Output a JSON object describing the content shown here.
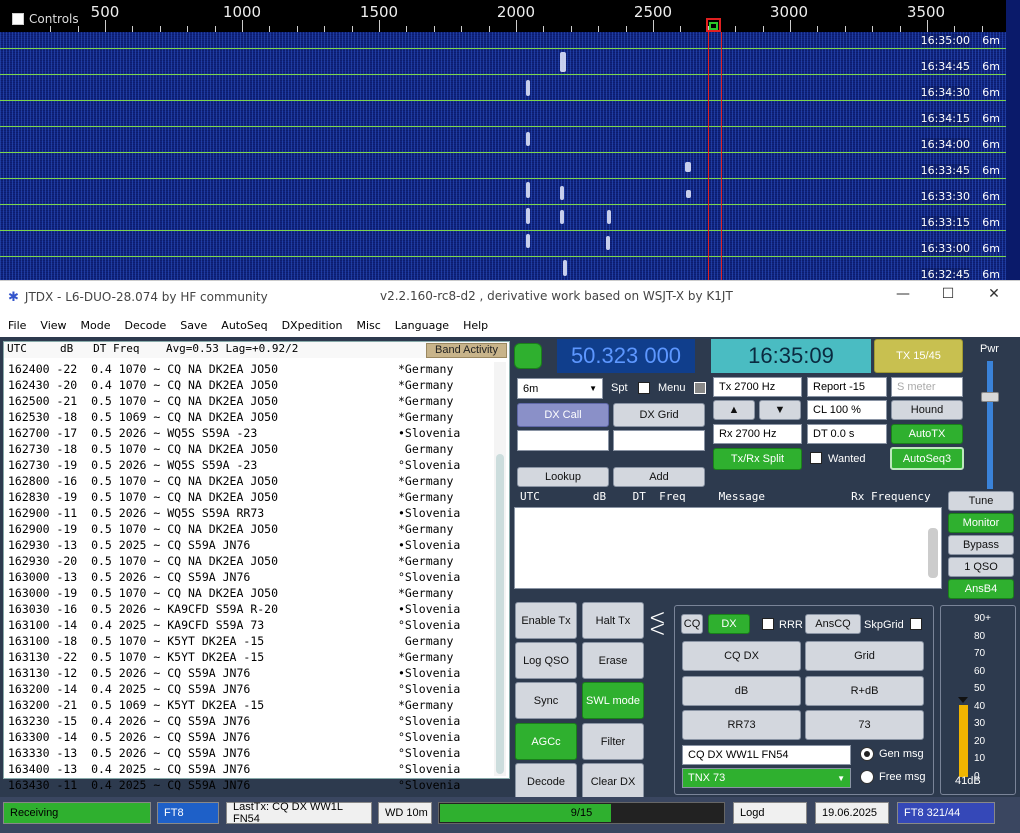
{
  "waterfall": {
    "controls_label": "Controls",
    "scale_labels": [
      "500",
      "1000",
      "1500",
      "2000",
      "2500",
      "3000",
      "3500"
    ],
    "times": [
      "16:35:00",
      "16:34:45",
      "16:34:30",
      "16:34:15",
      "16:34:00",
      "16:33:45",
      "16:33:30",
      "16:33:15",
      "16:33:00",
      "16:32:45"
    ],
    "band": "6m"
  },
  "titlebar": {
    "title": "JTDX - L6-DUO-28.074  by HF community",
    "version": "v2.2.160-rc8-d2 , derivative work based on WSJT-X by K1JT",
    "minimize": "—",
    "maximize": "☐",
    "close": "✕"
  },
  "menu": [
    "File",
    "View",
    "Mode",
    "Decode",
    "Save",
    "AutoSeq",
    "DXpedition",
    "Misc",
    "Language",
    "Help"
  ],
  "band_activity": {
    "header": "UTC     dB   DT Freq    Avg=0.53 Lag=+0.92/2",
    "button": "Band Activity",
    "rows": [
      {
        "t": "162400 -22  0.4 1070 ~ CQ NA DK2EA JO50",
        "c": "*Germany"
      },
      {
        "t": "162430 -20  0.4 1070 ~ CQ NA DK2EA JO50",
        "c": "*Germany"
      },
      {
        "t": "162500 -21  0.5 1070 ~ CQ NA DK2EA JO50",
        "c": "*Germany"
      },
      {
        "t": "162530 -18  0.5 1069 ~ CQ NA DK2EA JO50",
        "c": "*Germany"
      },
      {
        "t": "162700 -17  0.5 2026 ~ WQ5S S59A -23",
        "c": "•Slovenia"
      },
      {
        "t": "162730 -18  0.5 1070 ~ CQ NA DK2EA JO50",
        "c": " Germany"
      },
      {
        "t": "162730 -19  0.5 2026 ~ WQ5S S59A -23",
        "c": "°Slovenia"
      },
      {
        "t": "162800 -16  0.5 1070 ~ CQ NA DK2EA JO50",
        "c": "*Germany"
      },
      {
        "t": "162830 -19  0.5 1070 ~ CQ NA DK2EA JO50",
        "c": "*Germany"
      },
      {
        "t": "162900 -11  0.5 2026 ~ WQ5S S59A RR73",
        "c": "•Slovenia"
      },
      {
        "t": "162900 -19  0.5 1070 ~ CQ NA DK2EA JO50",
        "c": "*Germany"
      },
      {
        "t": "162930 -13  0.5 2025 ~ CQ S59A JN76",
        "c": "•Slovenia"
      },
      {
        "t": "162930 -20  0.5 1070 ~ CQ NA DK2EA JO50",
        "c": "*Germany"
      },
      {
        "t": "163000 -13  0.5 2026 ~ CQ S59A JN76",
        "c": "°Slovenia"
      },
      {
        "t": "163000 -19  0.5 1070 ~ CQ NA DK2EA JO50",
        "c": "*Germany"
      },
      {
        "t": "163030 -16  0.5 2026 ~ KA9CFD S59A R-20",
        "c": "•Slovenia"
      },
      {
        "t": "163100 -14  0.4 2025 ~ KA9CFD S59A 73",
        "c": "°Slovenia"
      },
      {
        "t": "163100 -18  0.5 1070 ~ K5YT DK2EA -15",
        "c": " Germany"
      },
      {
        "t": "163130 -22  0.5 1070 ~ K5YT DK2EA -15",
        "c": "*Germany"
      },
      {
        "t": "163130 -12  0.5 2026 ~ CQ S59A JN76",
        "c": "•Slovenia"
      },
      {
        "t": "163200 -14  0.4 2025 ~ CQ S59A JN76",
        "c": "°Slovenia"
      },
      {
        "t": "163200 -21  0.5 1069 ~ K5YT DK2EA -15",
        "c": "*Germany"
      },
      {
        "t": "163230 -15  0.4 2026 ~ CQ S59A JN76",
        "c": "°Slovenia"
      },
      {
        "t": "163300 -14  0.5 2026 ~ CQ S59A JN76",
        "c": "°Slovenia"
      },
      {
        "t": "163330 -13  0.5 2026 ~ CQ S59A JN76",
        "c": "°Slovenia"
      },
      {
        "t": "163400 -13  0.4 2025 ~ CQ S59A JN76",
        "c": "°Slovenia"
      },
      {
        "t": "163430 -11  0.4 2025 ~ CQ S59A JN76",
        "c": "°Slovenia"
      }
    ]
  },
  "top": {
    "freq": "50.323 000",
    "clock": "16:35:09",
    "tx_period": "TX 15/45",
    "pwr": "Pwr",
    "band": "6m",
    "spt": "Spt",
    "menu": "Menu",
    "tx_hz": "Tx  2700  Hz",
    "rx_hz": "Rx  2700  Hz",
    "report": "Report -15",
    "smeter_placeholder": "S meter",
    "cl": "CL  100 %",
    "dt": "DT 0.0 s",
    "hound": "Hound",
    "autotx": "AutoTX",
    "split": "Tx/Rx Split",
    "wanted": "Wanted",
    "autoseq": "AutoSeq3",
    "dx_call": "DX Call",
    "dx_grid": "DX Grid",
    "lookup": "Lookup",
    "add": "Add",
    "up": "▲",
    "down": "▼"
  },
  "rx_header": "UTC        dB    DT  Freq     Message             Rx Frequency",
  "side": {
    "tune": "Tune",
    "monitor": "Monitor",
    "bypass": "Bypass",
    "one_qso": "1 QSO",
    "ansb4": "AnsB4"
  },
  "ctrl": {
    "enable_tx": "Enable Tx",
    "halt_tx": "Halt Tx",
    "log_qso": "Log QSO",
    "erase": "Erase",
    "sync": "Sync",
    "swl": "SWL mode",
    "agcc": "AGCc",
    "filter": "Filter",
    "decode": "Decode",
    "clear_dx": "Clear DX",
    "arrows": "⋀⋀"
  },
  "gen": {
    "cq": "CQ",
    "dx": "DX",
    "rrr": "RRR",
    "anscq": "AnsCQ",
    "skpgrid": "SkpGrid",
    "cqdx": "CQ DX",
    "grid": "Grid",
    "db": "dB",
    "rdb": "R+dB",
    "rr73": "RR73",
    "s73": "73",
    "msg": "CQ DX WW1L FN54",
    "gen_msg": "Gen msg",
    "tnx": "TNX 73",
    "free_msg": "Free msg"
  },
  "meter": {
    "scale": [
      "90+",
      "80",
      "70",
      "60",
      "50",
      "40",
      "30",
      "20",
      "10",
      "0"
    ],
    "level_db": 41,
    "reading": "41dB"
  },
  "status": {
    "state": "Receiving",
    "mode": "FT8",
    "lasttx": "LastTx: CQ DX WW1L FN54",
    "wd": "WD 10m",
    "progress": "9/15",
    "progress_value": 0.6,
    "logd": "Logd",
    "date": "19.06.2025",
    "mode_count": "FT8  321/44"
  },
  "colors": {
    "green": "#2fb02f",
    "accent_blue": "#2244aa",
    "wf_line": "#7cd64a"
  }
}
